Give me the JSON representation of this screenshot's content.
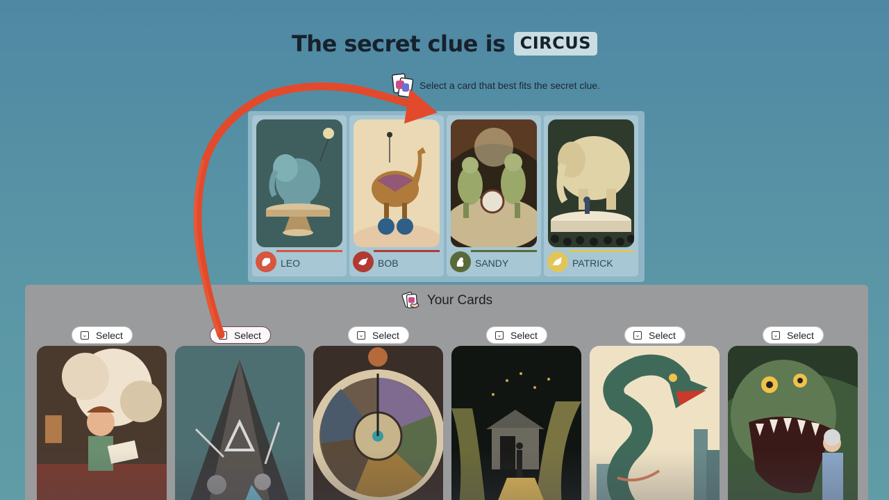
{
  "header": {
    "title_prefix": "The secret clue is",
    "clue_word": "CIRCUS",
    "instruction": "Select a card that best fits the secret clue."
  },
  "board": {
    "cards": [
      {
        "player": "LEO",
        "color": "#d6563f",
        "avatar_icon": "squirrel-icon",
        "art": "elephant-on-pedestal"
      },
      {
        "player": "BOB",
        "color": "#b23a33",
        "avatar_icon": "bird-icon",
        "art": "camel-on-balls"
      },
      {
        "player": "SANDY",
        "color": "#59693a",
        "avatar_icon": "seal-icon",
        "art": "dinosaur-band"
      },
      {
        "player": "PATRICK",
        "color": "#e2c55a",
        "avatar_icon": "eagle-icon",
        "art": "elephant-crowd"
      }
    ]
  },
  "hand": {
    "title": "Your Cards",
    "select_label": "Select",
    "cards": [
      {
        "art": "boy-reading-dreaming"
      },
      {
        "art": "pyramid-of-objects"
      },
      {
        "art": "wheel-of-fortune"
      },
      {
        "art": "shed-in-cornfield"
      },
      {
        "art": "serpent-over-city"
      },
      {
        "art": "monster-and-woman"
      }
    ]
  },
  "colors": {
    "background": "#5a96a6",
    "board": "#8fb6c6",
    "hand_panel": "#9a9b9c",
    "annotation_arrow": "#e24a2b"
  }
}
